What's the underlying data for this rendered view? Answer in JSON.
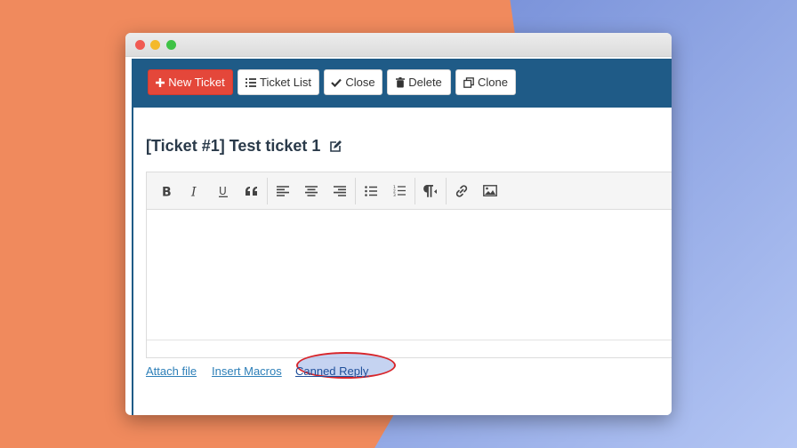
{
  "toolbar": {
    "new_ticket": "New Ticket",
    "ticket_list": "Ticket List",
    "close": "Close",
    "delete": "Delete",
    "clone": "Clone"
  },
  "ticket": {
    "title": "[Ticket #1] Test ticket 1"
  },
  "editor": {
    "buttons": [
      "bold-icon",
      "italic-icon",
      "underline-icon",
      "quote-icon",
      "align-left-icon",
      "align-center-icon",
      "align-right-icon",
      "bullet-list-icon",
      "numbered-list-icon",
      "paragraph-icon",
      "link-icon",
      "image-icon"
    ]
  },
  "links": {
    "attach_file": "Attach file",
    "insert_macros": "Insert Macros",
    "canned_reply": "Canned Reply"
  },
  "colors": {
    "topbar": "#1f5b87",
    "new_ticket_button": "#e4473a",
    "highlight_ring": "#d8262b",
    "link": "#2d7fb8"
  }
}
